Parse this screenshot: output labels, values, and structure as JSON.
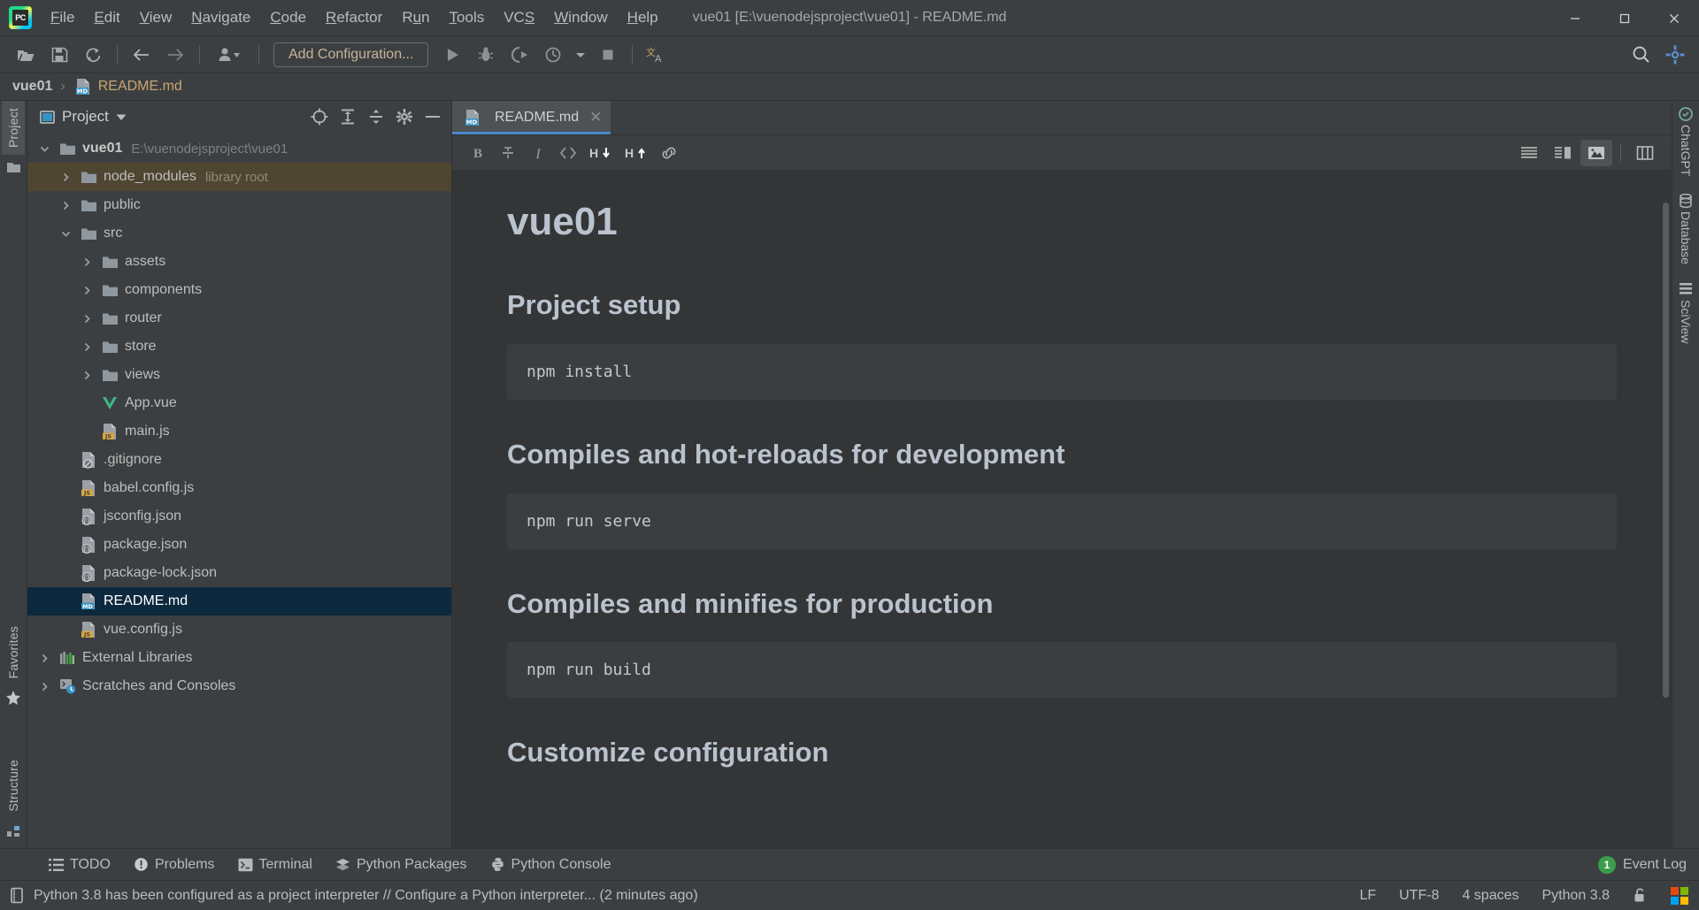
{
  "titlebar": {
    "logo": "pycharm-logo",
    "menus": [
      {
        "label": "File",
        "mnemonic": "F"
      },
      {
        "label": "Edit",
        "mnemonic": "E"
      },
      {
        "label": "View",
        "mnemonic": "V"
      },
      {
        "label": "Navigate",
        "mnemonic": "N"
      },
      {
        "label": "Code",
        "mnemonic": "C"
      },
      {
        "label": "Refactor",
        "mnemonic": "R"
      },
      {
        "label": "Run",
        "mnemonic": "u"
      },
      {
        "label": "Tools",
        "mnemonic": "T"
      },
      {
        "label": "VCS",
        "mnemonic": "S"
      },
      {
        "label": "Window",
        "mnemonic": "W"
      },
      {
        "label": "Help",
        "mnemonic": "H"
      }
    ],
    "window_title": "vue01 [E:\\vuenodejsproject\\vue01] - README.md",
    "minimize": "—",
    "maximize": "☐",
    "close": "✕"
  },
  "toolbar": {
    "open_label": "Open",
    "save_label": "Save All",
    "sync_label": "Synchronize",
    "back_label": "Back",
    "forward_label": "Forward",
    "profile_label": "Select Run Profile",
    "add_configuration": "Add Configuration...",
    "run_label": "Run",
    "debug_label": "Debug",
    "run_coverage_label": "Run with Coverage",
    "profile_run_label": "Profile",
    "stop_label": "Stop",
    "translate_label": "Translate",
    "search_label": "Search Everywhere",
    "settings_label": "Settings"
  },
  "breadcrumb": {
    "root": "vue01",
    "separator": "›",
    "file": "README.md",
    "file_icon": "md-file-icon"
  },
  "left_rail": {
    "project_tab": "Project",
    "structure_tab": "Structure",
    "favorites_tab": "Favorites"
  },
  "right_rail": {
    "items": [
      {
        "label": "ChatGPT",
        "icon": "chatgpt-icon"
      },
      {
        "label": "Database",
        "icon": "database-icon"
      },
      {
        "label": "SciView",
        "icon": "sciview-icon"
      }
    ]
  },
  "project_panel": {
    "title": "Project",
    "actions": [
      {
        "name": "select-opened-file",
        "icon": "crosshair-icon"
      },
      {
        "name": "expand-all",
        "icon": "expand-all-icon"
      },
      {
        "name": "collapse-all",
        "icon": "collapse-all-icon"
      },
      {
        "name": "settings",
        "icon": "gear-icon"
      },
      {
        "name": "hide",
        "icon": "minus-icon"
      }
    ],
    "tree": [
      {
        "label": "vue01",
        "sub": "E:\\vuenodejsproject\\vue01",
        "icon": "folder-icon",
        "indent": 0,
        "arrow": "down",
        "bold": true,
        "state": "normal"
      },
      {
        "label": "node_modules",
        "sub": "library root",
        "icon": "folder-icon",
        "indent": 1,
        "arrow": "right",
        "bold": false,
        "state": "library"
      },
      {
        "label": "public",
        "sub": "",
        "icon": "folder-icon",
        "indent": 1,
        "arrow": "right",
        "bold": false,
        "state": "normal"
      },
      {
        "label": "src",
        "sub": "",
        "icon": "folder-icon",
        "indent": 1,
        "arrow": "down",
        "bold": false,
        "state": "normal"
      },
      {
        "label": "assets",
        "sub": "",
        "icon": "folder-icon",
        "indent": 2,
        "arrow": "right",
        "bold": false,
        "state": "normal"
      },
      {
        "label": "components",
        "sub": "",
        "icon": "folder-icon",
        "indent": 2,
        "arrow": "right",
        "bold": false,
        "state": "normal"
      },
      {
        "label": "router",
        "sub": "",
        "icon": "folder-icon",
        "indent": 2,
        "arrow": "right",
        "bold": false,
        "state": "normal"
      },
      {
        "label": "store",
        "sub": "",
        "icon": "folder-icon",
        "indent": 2,
        "arrow": "right",
        "bold": false,
        "state": "normal"
      },
      {
        "label": "views",
        "sub": "",
        "icon": "folder-icon",
        "indent": 2,
        "arrow": "right",
        "bold": false,
        "state": "normal"
      },
      {
        "label": "App.vue",
        "sub": "",
        "icon": "vue-file-icon",
        "indent": 2,
        "arrow": "none",
        "bold": false,
        "state": "normal"
      },
      {
        "label": "main.js",
        "sub": "",
        "icon": "js-file-icon",
        "indent": 2,
        "arrow": "none",
        "bold": false,
        "state": "normal"
      },
      {
        "label": ".gitignore",
        "sub": "",
        "icon": "gitignore-file-icon",
        "indent": 1,
        "arrow": "none",
        "bold": false,
        "state": "normal"
      },
      {
        "label": "babel.config.js",
        "sub": "",
        "icon": "js-file-icon",
        "indent": 1,
        "arrow": "none",
        "bold": false,
        "state": "normal"
      },
      {
        "label": "jsconfig.json",
        "sub": "",
        "icon": "json-file-icon",
        "indent": 1,
        "arrow": "none",
        "bold": false,
        "state": "normal"
      },
      {
        "label": "package.json",
        "sub": "",
        "icon": "json-file-icon",
        "indent": 1,
        "arrow": "none",
        "bold": false,
        "state": "normal"
      },
      {
        "label": "package-lock.json",
        "sub": "",
        "icon": "json-file-icon",
        "indent": 1,
        "arrow": "none",
        "bold": false,
        "state": "normal"
      },
      {
        "label": "README.md",
        "sub": "",
        "icon": "md-file-icon",
        "indent": 1,
        "arrow": "none",
        "bold": false,
        "state": "selected"
      },
      {
        "label": "vue.config.js",
        "sub": "",
        "icon": "js-file-icon",
        "indent": 1,
        "arrow": "none",
        "bold": false,
        "state": "normal"
      },
      {
        "label": "External Libraries",
        "sub": "",
        "icon": "libraries-icon",
        "indent": 0,
        "arrow": "right",
        "bold": false,
        "state": "normal"
      },
      {
        "label": "Scratches and Consoles",
        "sub": "",
        "icon": "scratches-icon",
        "indent": 0,
        "arrow": "right",
        "bold": false,
        "state": "normal"
      }
    ]
  },
  "editor": {
    "tabs": [
      {
        "label": "README.md",
        "icon": "md-file-icon",
        "close": "✕",
        "active": true
      }
    ],
    "md_toolbar": [
      {
        "name": "bold-button",
        "glyph": "B",
        "title": "Bold"
      },
      {
        "name": "strikethrough-button",
        "glyph": "S",
        "title": "Strikethrough"
      },
      {
        "name": "italic-button",
        "glyph": "I",
        "title": "Italic"
      },
      {
        "name": "code-button",
        "glyph": "<>",
        "title": "Code"
      },
      {
        "name": "header-down-button",
        "glyph": "H↓",
        "title": "Decrease Header Level"
      },
      {
        "name": "header-up-button",
        "glyph": "H↑",
        "title": "Increase Header Level"
      },
      {
        "name": "link-button",
        "glyph": "ὑ7",
        "title": "Insert Link"
      }
    ],
    "view_modes": [
      {
        "name": "editor-only-view",
        "active": false
      },
      {
        "name": "editor-and-preview-view",
        "active": false
      },
      {
        "name": "preview-only-view",
        "active": true
      },
      {
        "name": "split-layout-view",
        "active": false
      }
    ]
  },
  "preview": {
    "title": "vue01",
    "sections": [
      {
        "heading": "Project setup",
        "code": "npm install"
      },
      {
        "heading": "Compiles and hot-reloads for development",
        "code": "npm run serve"
      },
      {
        "heading": "Compiles and minifies for production",
        "code": "npm run build"
      }
    ],
    "next_heading": "Customize configuration"
  },
  "tool_windows": {
    "items": [
      {
        "label": "TODO",
        "icon": "todo-icon"
      },
      {
        "label": "Problems",
        "icon": "problems-icon"
      },
      {
        "label": "Terminal",
        "icon": "terminal-icon"
      },
      {
        "label": "Python Packages",
        "icon": "python-packages-icon"
      },
      {
        "label": "Python Console",
        "icon": "python-console-icon"
      }
    ],
    "event_log": {
      "label": "Event Log",
      "count": "1"
    }
  },
  "statusbar": {
    "message": "Python 3.8 has been configured as a project interpreter // Configure a Python interpreter... (2 minutes ago)",
    "line_separator": "LF",
    "encoding": "UTF-8",
    "indent": "4 spaces",
    "interpreter": "Python 3.8",
    "lock_icon": "unlocked-icon",
    "os_icon": "windows-icon"
  },
  "colors": {
    "accent_blue": "#4a88c7",
    "selection_blue": "#0d293e",
    "library_brown": "#4f4632",
    "panel_bg": "#3c3f41",
    "preview_bg": "#333537",
    "heading_text": "#bac3cd",
    "badge_green": "#3c9e4c",
    "md_badge": "#3592c4",
    "js_badge": "#d9a641",
    "vue_green": "#41b883"
  }
}
